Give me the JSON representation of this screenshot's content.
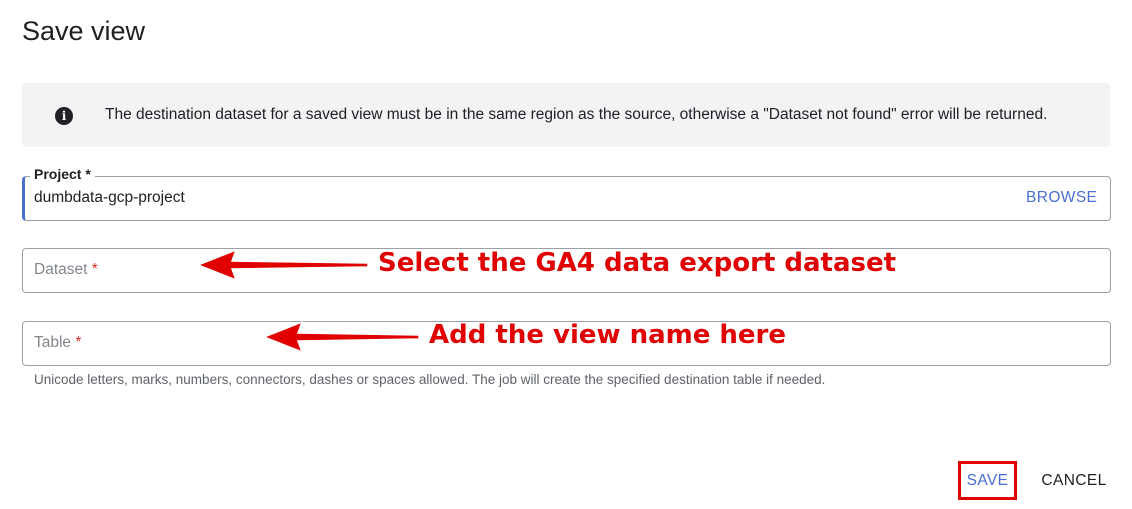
{
  "dialog": {
    "title": "Save view"
  },
  "info": {
    "icon": "info-icon",
    "glyph": "i",
    "text": "The destination dataset for a saved view must be in the same region as the source, otherwise a \"Dataset not found\" error will be returned."
  },
  "project": {
    "label": "Project *",
    "value": "dumbdata-gcp-project",
    "browse_label": "BROWSE"
  },
  "dataset": {
    "placeholder": "Dataset",
    "required_mark": "*"
  },
  "table": {
    "placeholder": "Table",
    "required_mark": "*",
    "hint": "Unicode letters, marks, numbers, connectors, dashes or spaces allowed. The job will create the specified destination table if needed."
  },
  "annotations": {
    "dataset_note": "Select the GA4 data export dataset",
    "table_note": "Add the view name here",
    "color": "#e00000"
  },
  "actions": {
    "save_label": "SAVE",
    "cancel_label": "CANCEL"
  },
  "colors": {
    "accent": "#4a6fd1",
    "required": "#d93025",
    "banner_bg": "#f1f3f4"
  }
}
